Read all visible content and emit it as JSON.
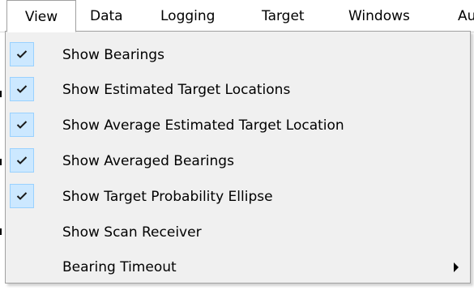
{
  "menubar": {
    "items": [
      {
        "label": "View"
      },
      {
        "label": "Data"
      },
      {
        "label": "Logging"
      },
      {
        "label": "Target"
      },
      {
        "label": "Windows"
      },
      {
        "label": "Au"
      }
    ]
  },
  "view_menu": {
    "items": [
      {
        "label": "Show Bearings",
        "checked": true
      },
      {
        "label": "Show Estimated Target Locations",
        "checked": true
      },
      {
        "label": "Show Average Estimated Target Location",
        "checked": true
      },
      {
        "label": "Show Averaged Bearings",
        "checked": true
      },
      {
        "label": "Show Target Probability Ellipse",
        "checked": true
      },
      {
        "label": "Show Scan Receiver",
        "checked": false
      },
      {
        "label": "Bearing Timeout",
        "checked": false,
        "has_submenu": true
      }
    ]
  },
  "colors": {
    "menu_background": "#f0f0f0",
    "check_highlight": "#cce8ff",
    "check_border": "#99d1ff",
    "menu_border": "#a0a0a0"
  }
}
